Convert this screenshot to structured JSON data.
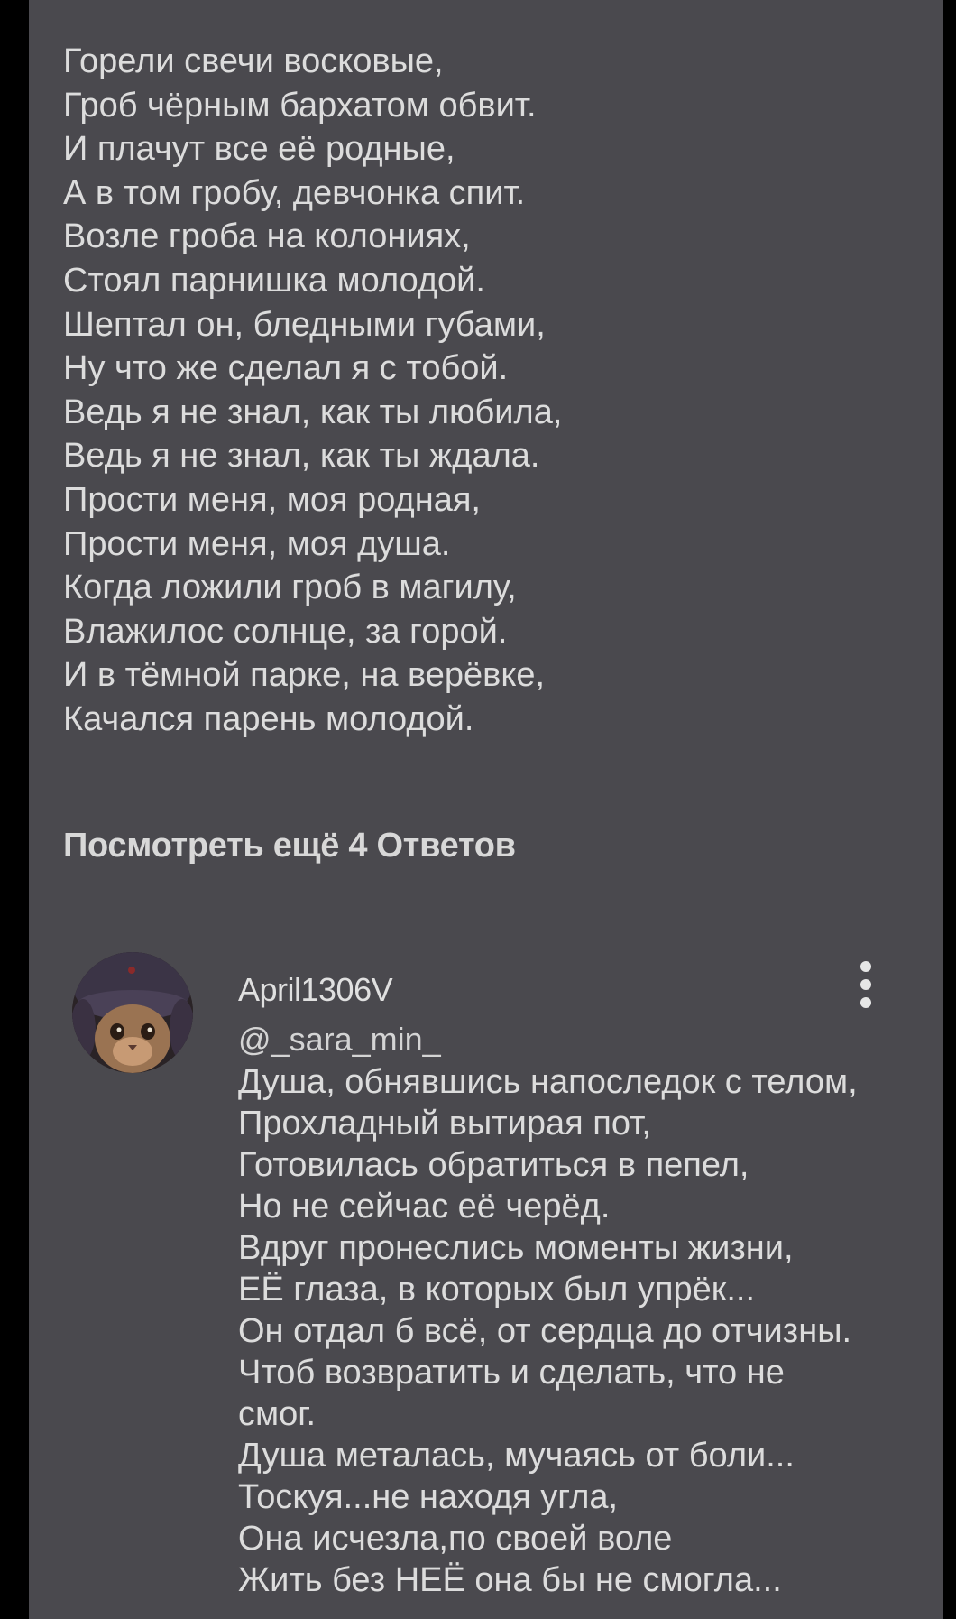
{
  "thread": {
    "poem_lines": [
      "Горели свечи восковые,",
      "Гроб чёрным бархатом обвит.",
      "И плачут все её родные,",
      "А в том гробу, девчонка спит.",
      "Возле гроба на колониях,",
      "Стоял парнишка молодой.",
      "Шептал он, бледными губами,",
      "Ну что же сделал я с тобой.",
      "Ведь я не знал,  как ты любила,",
      "Ведь я не знал,  как ты ждала.",
      "Прости меня,  моя родная,",
      "Прости меня, моя душа.",
      "Когда ложили гроб в магилу,",
      "Влажилос солнце, за горой.",
      "И в тёмной парке, на верёвке,",
      "Качался парень молодой."
    ],
    "more_replies_label": "Посмотреть ещё 4 Ответов"
  },
  "reply": {
    "author": "April1306V",
    "mention": "@_sara_min_",
    "lines": [
      "Душа, обнявшись напоследок с телом,",
      "Прохладный вытирая пот,",
      "Готовилась обратиться в пепел,",
      "Но не сейчас её черёд.",
      "Вдруг пронеслись моменты жизни,",
      "ЕЁ глаза, в которых был упрёк...",
      "Он отдал б всё, от сердца до отчизны.",
      "Чтоб возвратить и сделать, что не",
      "смог.",
      "Душа металась, мучаясь от боли...",
      "Тоскуя...не находя угла,",
      "Она исчезла,по своей воле",
      "Жить без НЕЁ она бы не смогла..."
    ],
    "menu_icon": "more-vertical-icon"
  },
  "colors": {
    "background": "#4a494e",
    "outer": "#000000",
    "text": "#dcdcdc"
  }
}
